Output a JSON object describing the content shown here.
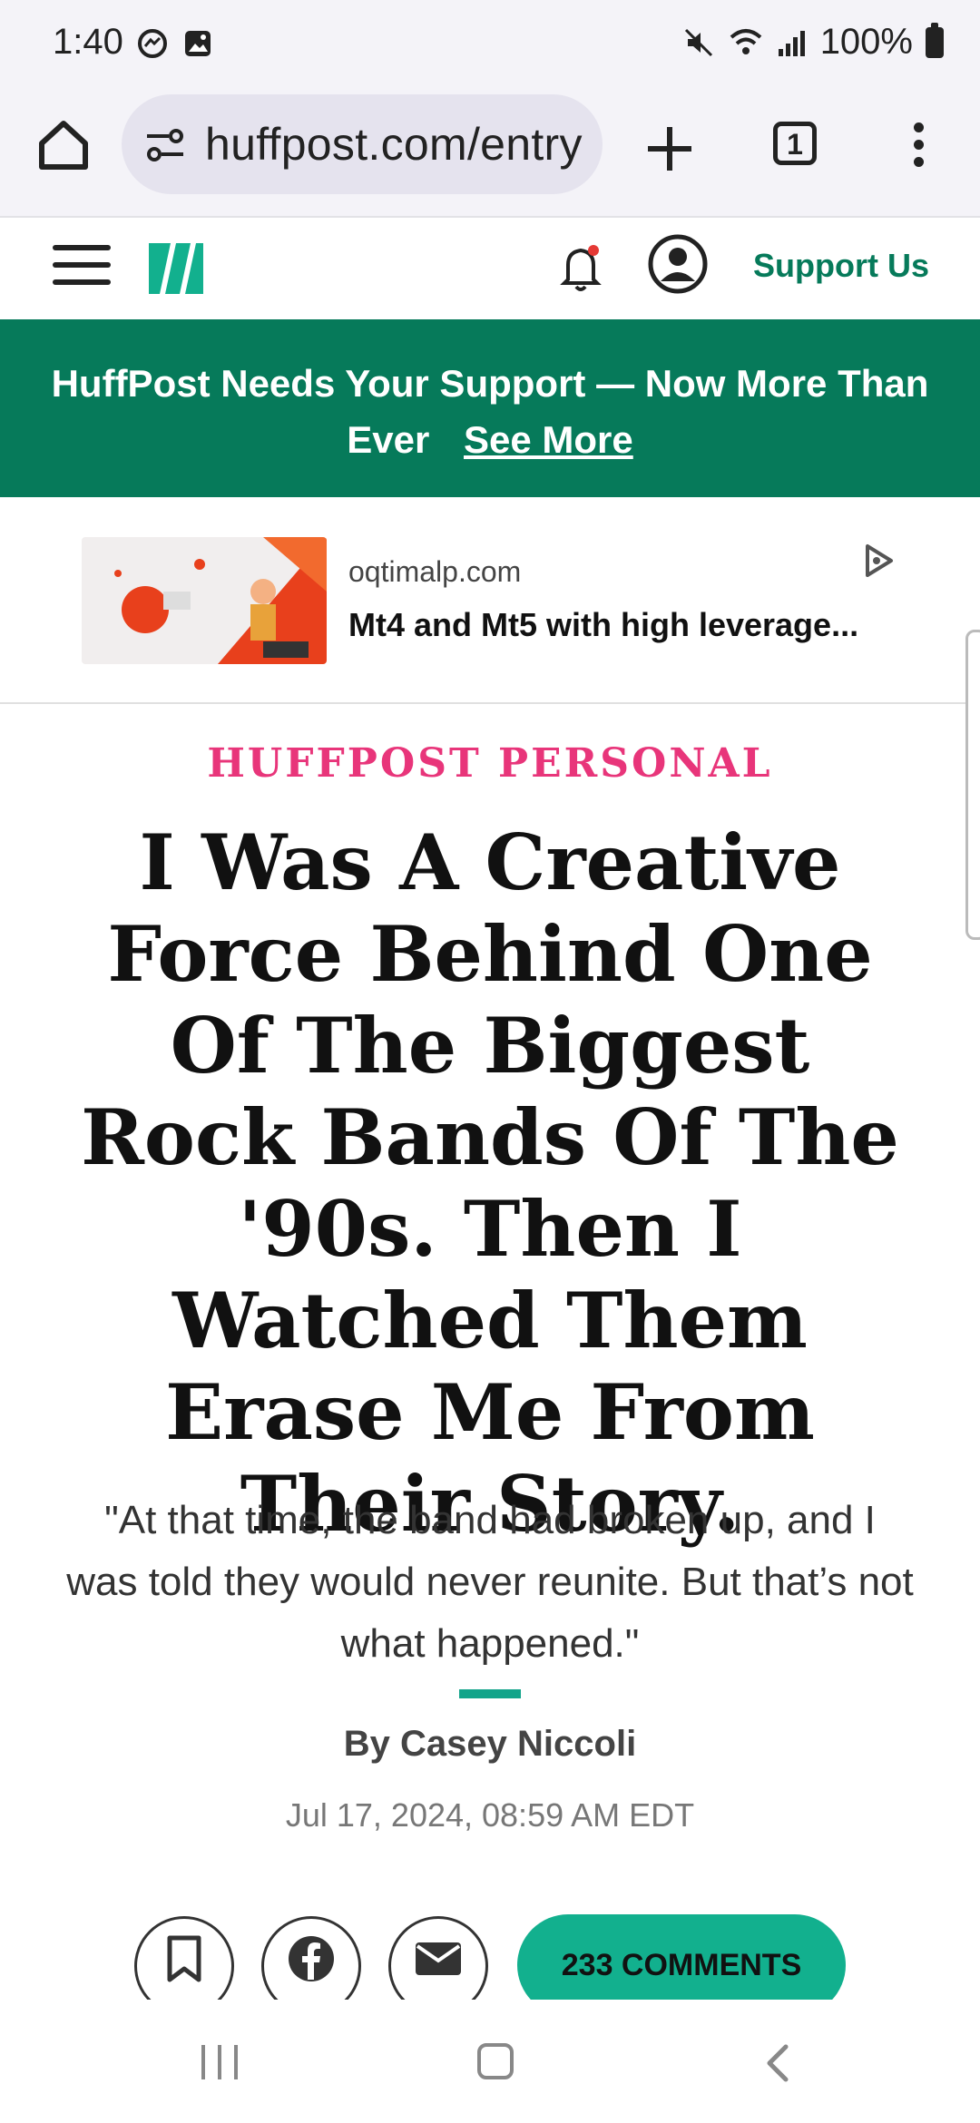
{
  "status_bar": {
    "time": "1:40",
    "battery": "100%"
  },
  "browser": {
    "url": "huffpost.com/entry",
    "tab_count": "1"
  },
  "header": {
    "support_label": "Support Us"
  },
  "banner": {
    "text": "HuffPost Needs Your Support — Now More Than Ever",
    "link": "See More"
  },
  "ad": {
    "domain": "oqtimalp.com",
    "title": "Mt4 and Mt5 with high leverage..."
  },
  "article": {
    "kicker": "HUFFPOST PERSONAL",
    "headline": "I Was A Creative Force Behind One Of The Biggest Rock Bands Of The '90s. Then I Watched Them Erase Me From Their Story.",
    "dek": "\"At that time, the band had broken up, and I was told they would never reunite. But that’s not what happened.\"",
    "byline": "By Casey Niccoli",
    "date": "Jul 17, 2024, 08:59 AM EDT"
  },
  "share": {
    "comments_label": "233 COMMENTS"
  },
  "colors": {
    "brand_green": "#067a5a",
    "kicker_pink": "#e8357a",
    "accent_teal": "#12b08e"
  }
}
